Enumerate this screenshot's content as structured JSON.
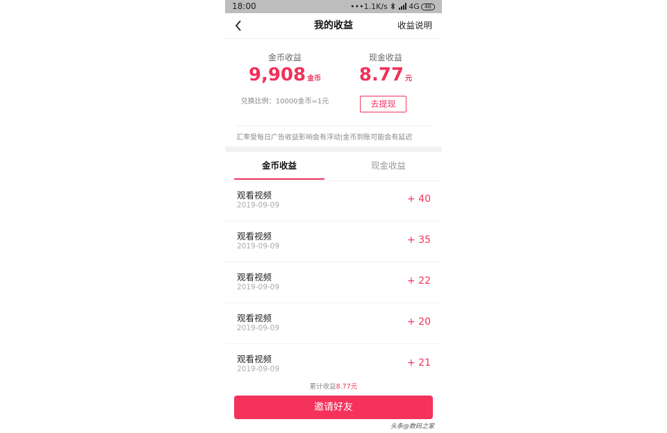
{
  "status_bar": {
    "time": "18:00",
    "network_speed": "1.1K/s",
    "network_type": "4G",
    "battery": "46",
    "icons": [
      "signal-dots-icon",
      "bluetooth-icon",
      "signal-bars-icon"
    ]
  },
  "nav": {
    "title": "我的收益",
    "right_link": "收益说明",
    "back_icon": "chevron-left-icon"
  },
  "summary": {
    "coins_label": "金币收益",
    "coins_value": "9,908",
    "coins_unit": "金币",
    "cash_label": "现金收益",
    "cash_value": "8.77",
    "cash_unit": "元",
    "exchange_rate": "兑换比例：10000金币=1元",
    "withdraw_button": "去提现",
    "notice": "汇率受每日广告收益影响会有浮动|金币到账可能会有延迟"
  },
  "tabs": [
    {
      "label": "金币收益",
      "active": true
    },
    {
      "label": "现金收益",
      "active": false
    }
  ],
  "records": [
    {
      "title": "观看视频",
      "date": "2019-09-09",
      "amount": "+ 40"
    },
    {
      "title": "观看视频",
      "date": "2019-09-09",
      "amount": "+ 35"
    },
    {
      "title": "观看视频",
      "date": "2019-09-09",
      "amount": "+ 22"
    },
    {
      "title": "观看视频",
      "date": "2019-09-09",
      "amount": "+ 20"
    },
    {
      "title": "观看视频",
      "date": "2019-09-09",
      "amount": "+ 21"
    }
  ],
  "footer": {
    "total_label": "累计收益",
    "total_value": "8.77元",
    "invite_button": "邀请好友"
  },
  "watermark": "头条@数码之家",
  "colors": {
    "accent": "#f0325a",
    "status_bar": "#bdbdbd"
  }
}
